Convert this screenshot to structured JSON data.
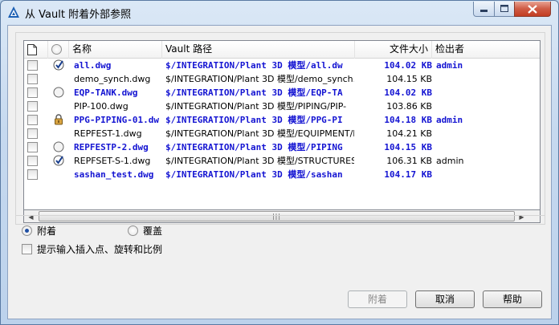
{
  "window": {
    "title": "从 Vault 附着外部参照"
  },
  "grid": {
    "columns": {
      "name": "名称",
      "path": "Vault 路径",
      "size": "文件大小",
      "checked_out_by": "检出者"
    },
    "rows": [
      {
        "style": "bold",
        "icon": "checked-out-icon",
        "name": "all.dwg",
        "path": "$/INTEGRATION/Plant 3D 模型/all.dw",
        "size": "104.02 KB",
        "checked_out_by": "admin"
      },
      {
        "style": "normal",
        "icon": "",
        "name": "demo_synch.dwg",
        "path": "$/INTEGRATION/Plant 3D 模型/demo_synch.",
        "size": "104.15 KB",
        "checked_out_by": ""
      },
      {
        "style": "bold",
        "icon": "available-icon",
        "name": "EQP-TANK.dwg",
        "path": "$/INTEGRATION/Plant 3D 模型/EQP-TA",
        "size": "104.02 KB",
        "checked_out_by": ""
      },
      {
        "style": "normal",
        "icon": "",
        "name": "PIP-100.dwg",
        "path": "$/INTEGRATION/Plant 3D 模型/PIPING/PIP-",
        "size": "103.86 KB",
        "checked_out_by": ""
      },
      {
        "style": "bold",
        "icon": "lock-icon",
        "name": "PPG-PIPING-01.dw",
        "path": "$/INTEGRATION/Plant 3D 模型/PPG-PI",
        "size": "104.18 KB",
        "checked_out_by": "admin"
      },
      {
        "style": "normal",
        "icon": "",
        "name": "REPFEST-1.dwg",
        "path": "$/INTEGRATION/Plant 3D 模型/EQUIPMENT/R",
        "size": "104.21 KB",
        "checked_out_by": ""
      },
      {
        "style": "bold",
        "icon": "available-icon",
        "name": "REPFESTP-2.dwg",
        "path": "$/INTEGRATION/Plant 3D 模型/PIPING",
        "size": "104.15 KB",
        "checked_out_by": ""
      },
      {
        "style": "normal",
        "icon": "checked-out-icon",
        "name": "REPFSET-S-1.dwg",
        "path": "$/INTEGRATION/Plant 3D 模型/STRUCTURES/",
        "size": "106.31 KB",
        "checked_out_by": "admin"
      },
      {
        "style": "bold",
        "icon": "",
        "name": "sashan_test.dwg",
        "path": "$/INTEGRATION/Plant 3D 模型/sashan",
        "size": "104.17 KB",
        "checked_out_by": ""
      }
    ]
  },
  "options": {
    "attach_label": "附着",
    "attach_selected": true,
    "overlay_label": "覆盖",
    "prompt_label": "提示输入插入点、旋转和比例"
  },
  "buttons": {
    "attach": "附着",
    "cancel": "取消",
    "help": "帮助"
  },
  "colors": {
    "accent": "#1414d2",
    "close": "#c33d22"
  }
}
